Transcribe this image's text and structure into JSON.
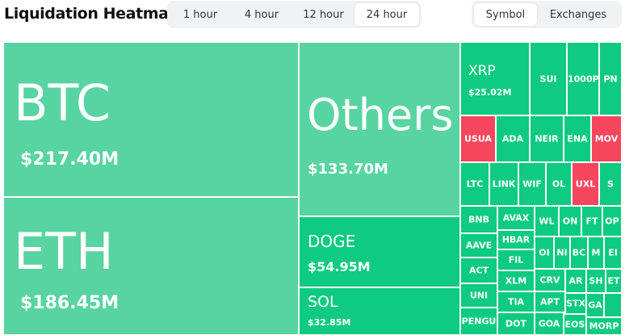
{
  "header": {
    "title": "Liquidation Heatmap",
    "time_tabs": [
      "1 hour",
      "4 hour",
      "12 hour",
      "24 hour"
    ],
    "active_time_tab": "24 hour",
    "view_tabs": [
      "Symbol",
      "Exchanges"
    ],
    "active_view_tab": "Symbol"
  },
  "colors": {
    "green": "#0ecb81",
    "light_green": "#57d4a1",
    "red": "#f6465d"
  },
  "tiles": {
    "btc": {
      "symbol": "BTC",
      "value": "$217.40M"
    },
    "eth": {
      "symbol": "ETH",
      "value": "$186.45M"
    },
    "others": {
      "symbol": "Others",
      "value": "$133.70M"
    },
    "doge": {
      "symbol": "DOGE",
      "value": "$54.95M"
    },
    "sol": {
      "symbol": "SOL",
      "value": "$32.85M"
    },
    "xrp": {
      "symbol": "XRP",
      "value": "$25.02M"
    },
    "small": [
      "SUI",
      "1000P",
      "PN",
      "USUA",
      "ADA",
      "NEIR",
      "ENA",
      "MOV",
      "LTC",
      "LINK",
      "WIF",
      "OL",
      "UXL",
      "S",
      "BNB",
      "AVAX",
      "WL",
      "ON",
      "FT",
      "OP",
      "AAVE",
      "HBAR",
      "OI",
      "NI",
      "BC",
      "M",
      "EI",
      "FIL",
      "ACT",
      "CRV",
      "AR",
      "SH",
      "ET",
      "UNI",
      "XLM",
      "APT",
      "STX",
      "GA",
      "TIA",
      "PENGU",
      "DOT",
      "GOA",
      "EOS",
      "MORP"
    ]
  }
}
